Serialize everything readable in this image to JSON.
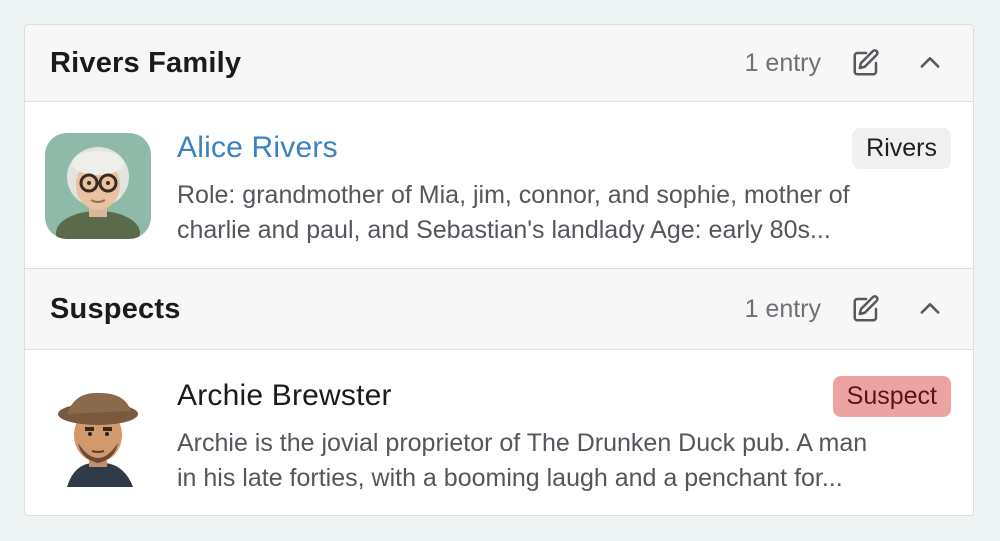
{
  "groups": [
    {
      "title": "Rivers Family",
      "count": "1 entry",
      "entries": [
        {
          "name": "Alice Rivers",
          "tag": "Rivers",
          "desc_line1": "Role: grandmother of Mia, jim, connor, and sophie, mother of",
          "desc_line2": "charlie and paul, and Sebastian's landlady Age: early 80s..."
        }
      ]
    },
    {
      "title": "Suspects",
      "count": "1 entry",
      "entries": [
        {
          "name": "Archie Brewster",
          "tag": "Suspect",
          "desc_line1": "Archie is the jovial proprietor of The Drunken Duck pub. A man",
          "desc_line2": "in his late forties, with a booming laugh and a penchant for..."
        }
      ]
    }
  ],
  "colors": {
    "link": "#3b82c4",
    "suspect_tag_bg": "#eea3a3",
    "neutral_tag_bg": "#f0f0f0"
  },
  "icons": {
    "edit": "edit-icon",
    "collapse": "chevron-up-icon"
  }
}
